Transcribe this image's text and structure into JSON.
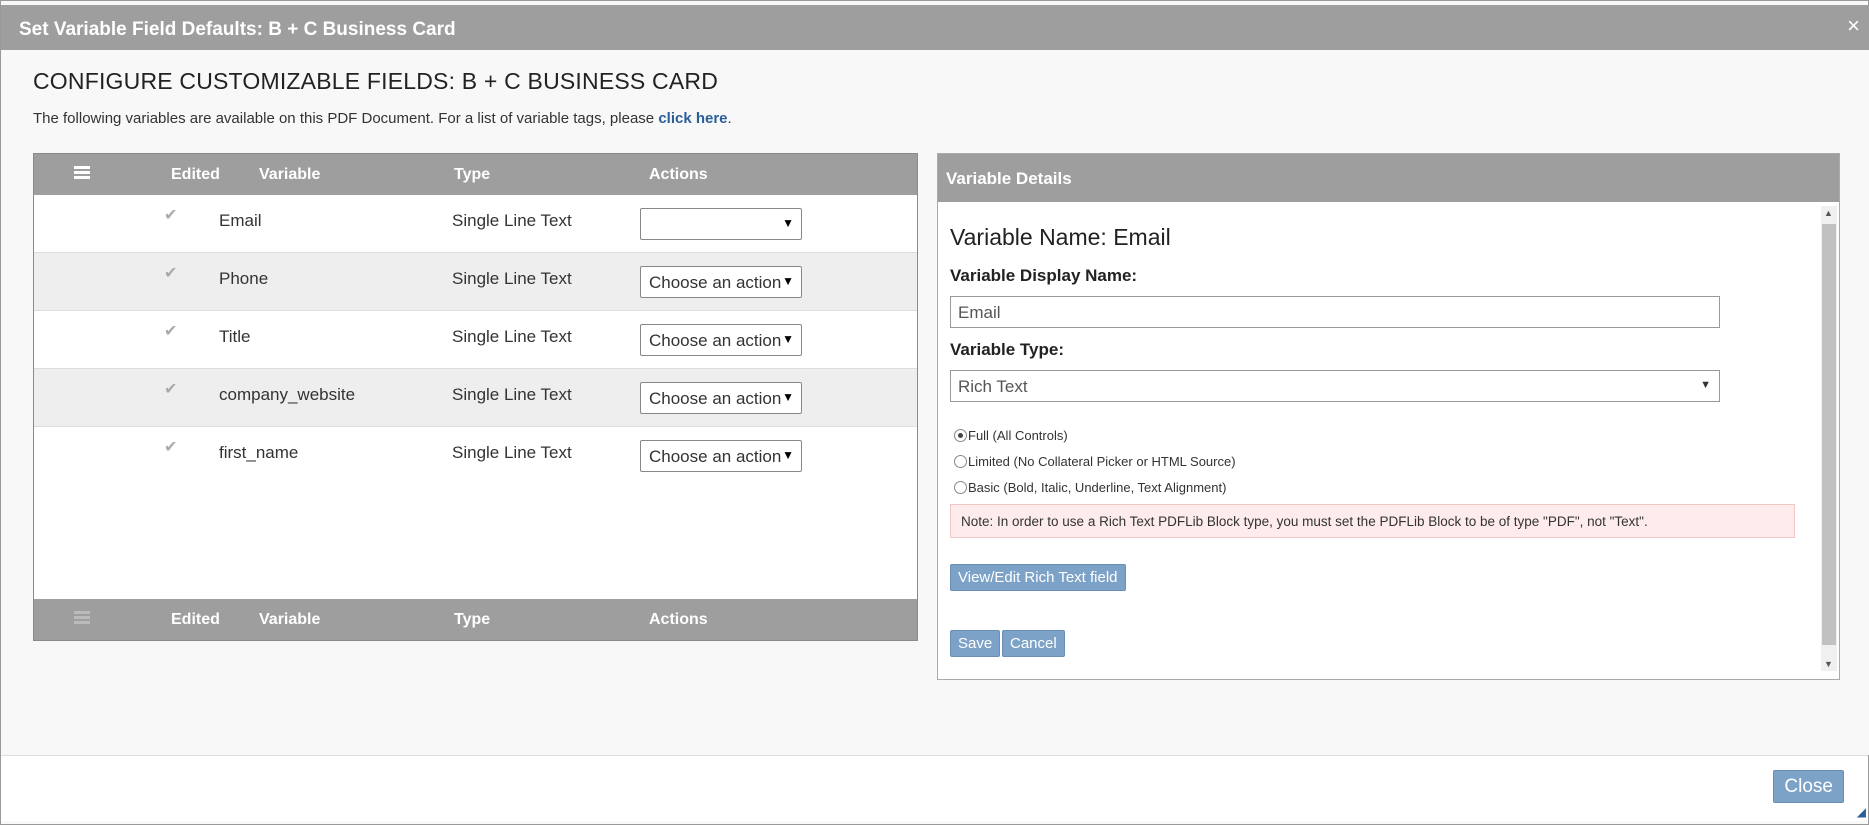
{
  "dialog": {
    "title": "Set Variable Field Defaults: B + C Business Card",
    "close_glyph": "×"
  },
  "heading": "CONFIGURE CUSTOMIZABLE FIELDS: B + C BUSINESS CARD",
  "subtext": {
    "text": "The following variables are available on this PDF Document. For a list of variable tags, please",
    "link": "click here",
    "end": "."
  },
  "table": {
    "columns": {
      "edited": "Edited",
      "variable": "Variable",
      "type": "Type",
      "actions": "Actions"
    },
    "rows": [
      {
        "variable": "Email",
        "type": "Single Line Text",
        "action": ""
      },
      {
        "variable": "Phone",
        "type": "Single Line Text",
        "action": "Choose an action"
      },
      {
        "variable": "Title",
        "type": "Single Line Text",
        "action": "Choose an action"
      },
      {
        "variable": "company_website",
        "type": "Single Line Text",
        "action": "Choose an action"
      },
      {
        "variable": "first_name",
        "type": "Single Line Text",
        "action": "Choose an action"
      }
    ]
  },
  "details": {
    "header": "Variable Details",
    "variable_name": "Variable Name: Email",
    "display_name_label": "Variable Display Name:",
    "display_name_value": "Email",
    "type_label": "Variable Type:",
    "type_value": "Rich Text",
    "radios": [
      {
        "label": "Full (All Controls)",
        "checked": true
      },
      {
        "label": "Limited (No Collateral Picker or HTML Source)",
        "checked": false
      },
      {
        "label": "Basic (Bold, Italic, Underline, Text Alignment)",
        "checked": false
      }
    ],
    "note": "Note: In order to use a Rich Text PDFLib Block type, you must set the PDFLib Block to be of type \"PDF\", not \"Text\".",
    "view_edit_button": "View/Edit Rich Text field",
    "save_button": "Save",
    "cancel_button": "Cancel"
  },
  "footer": {
    "close_button": "Close"
  },
  "colors": {
    "header_gray": "#9e9e9e",
    "button_blue": "#7da2c8",
    "link_blue": "#2a5f9a",
    "note_bg": "#fdeceb"
  }
}
